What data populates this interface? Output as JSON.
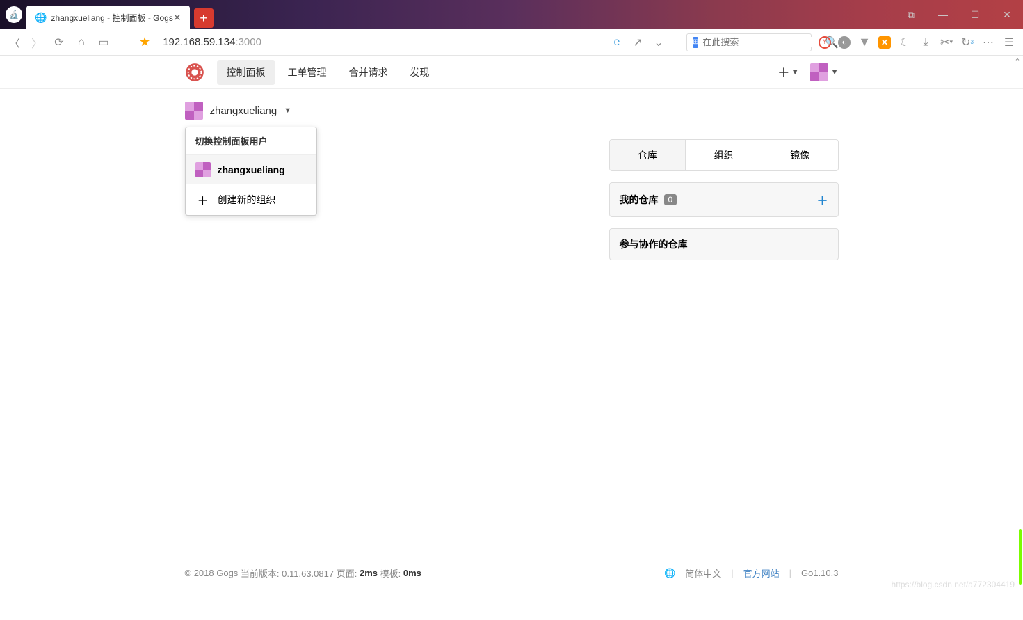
{
  "browser": {
    "tab_title": "zhangxueliang - 控制面板 - Gogs",
    "url_host": "192.168.59.134",
    "url_port": ":3000",
    "search_placeholder": "在此搜索"
  },
  "nav": {
    "items": [
      "控制面板",
      "工单管理",
      "合并请求",
      "发现"
    ]
  },
  "user": {
    "name": "zhangxueliang"
  },
  "dropdown": {
    "header": "切换控制面板用户",
    "user_item": "zhangxueliang",
    "create_org": "创建新的组织"
  },
  "right": {
    "tabs": [
      "仓库",
      "组织",
      "镜像"
    ],
    "my_repos": "我的仓库",
    "repo_count": "0",
    "collab_repos": "参与协作的仓库"
  },
  "footer": {
    "copyright": "© 2018 Gogs",
    "version_label": "当前版本: 0.11.63.0817",
    "page_label": "页面:",
    "page_time": "2ms",
    "template_label": "模板:",
    "template_time": "0ms",
    "lang": "简体中文",
    "official": "官方网站",
    "go_version": "Go1.10.3"
  },
  "watermark": "https://blog.csdn.net/a772304419"
}
